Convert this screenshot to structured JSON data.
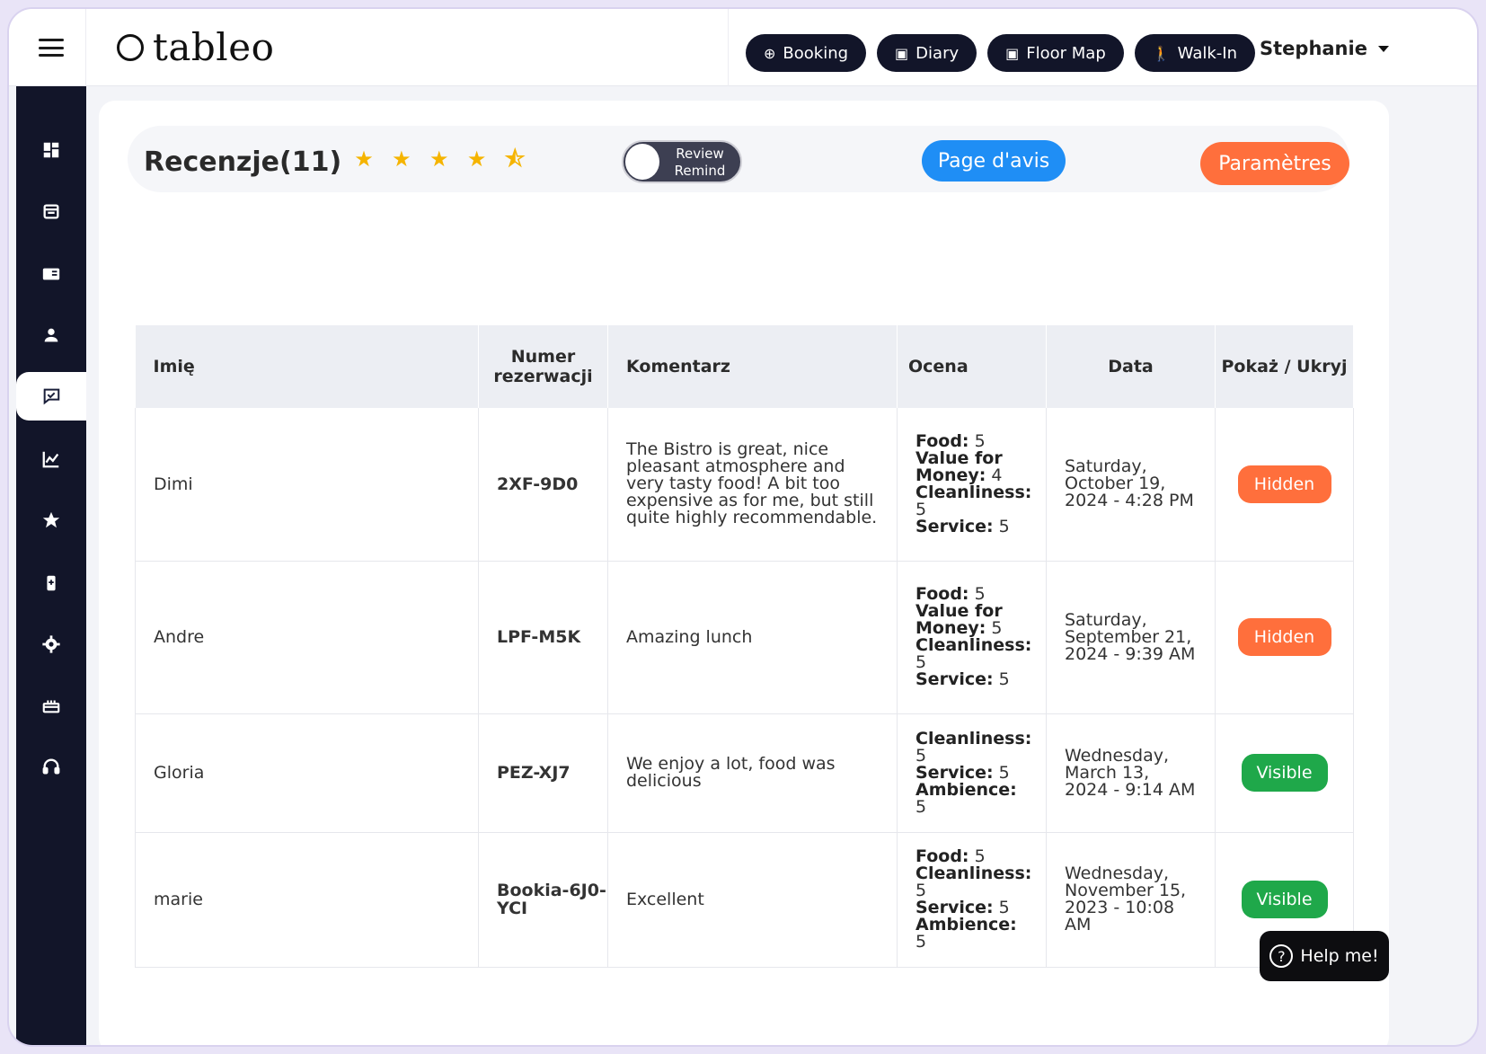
{
  "brand": {
    "logo_text": "tableo"
  },
  "topbar": {
    "actions": [
      {
        "label": "Booking",
        "icon": "plus-circle-icon"
      },
      {
        "label": "Diary",
        "icon": "calendar-icon"
      },
      {
        "label": "Floor Map",
        "icon": "map-icon"
      },
      {
        "label": "Walk-In",
        "icon": "walk-icon"
      }
    ],
    "user_name": "Stephanie"
  },
  "sidebar": {
    "items": [
      {
        "icon": "dashboard-icon"
      },
      {
        "icon": "calendar-icon"
      },
      {
        "icon": "book-icon"
      },
      {
        "icon": "user-icon"
      },
      {
        "icon": "review-icon",
        "active": true
      },
      {
        "icon": "chart-icon"
      },
      {
        "icon": "star-icon"
      },
      {
        "icon": "gift-card-icon"
      },
      {
        "icon": "gear-icon"
      },
      {
        "icon": "cake-icon"
      },
      {
        "icon": "headset-icon"
      }
    ]
  },
  "header": {
    "title": "Recenzje",
    "count": "(11)",
    "stars": "★ ★ ★ ★ ⯪",
    "toggle_label_line1": "Review",
    "toggle_label_line2": "Remind",
    "review_page_button": "Page d'avis",
    "settings_button": "Paramètres"
  },
  "table": {
    "headers": {
      "name": "Imię",
      "reservation": "Numer rezerwacji",
      "comment": "Komentarz",
      "rating": "Ocena",
      "date": "Data",
      "visibility": "Pokaż / Ukryj"
    },
    "rows": [
      {
        "name": "Dimi",
        "reservation": "2XF-9D0",
        "comment": "The Bistro is great, nice pleasant atmosphere and very tasty food! A bit too expensive as for me, but still quite highly recommendable.",
        "ratings": [
          {
            "label": "Food:",
            "value": "5"
          },
          {
            "label": "Value for Money:",
            "value": "4"
          },
          {
            "label": "Cleanliness:",
            "value": "5"
          },
          {
            "label": "Service:",
            "value": "5"
          }
        ],
        "date": "Saturday, October 19, 2024 - 4:28 PM",
        "status": "Hidden",
        "status_type": "hidden"
      },
      {
        "name": "Andre",
        "reservation": "LPF-M5K",
        "comment": "Amazing lunch",
        "ratings": [
          {
            "label": "Food:",
            "value": "5"
          },
          {
            "label": "Value for Money:",
            "value": "5"
          },
          {
            "label": "Cleanliness:",
            "value": "5"
          },
          {
            "label": "Service:",
            "value": "5"
          }
        ],
        "date": "Saturday, September 21, 2024 - 9:39 AM",
        "status": "Hidden",
        "status_type": "hidden"
      },
      {
        "name": "Gloria",
        "reservation": "PEZ-XJ7",
        "comment": "We enjoy a lot, food was delicious",
        "ratings": [
          {
            "label": "Cleanliness:",
            "value": "5"
          },
          {
            "label": "Service:",
            "value": "5"
          },
          {
            "label": "Ambience:",
            "value": "5"
          }
        ],
        "date": "Wednesday, March 13, 2024 - 9:14 AM",
        "status": "Visible",
        "status_type": "visible"
      },
      {
        "name": "marie",
        "reservation": "Bookia-6J0-YCI",
        "comment": "Excellent",
        "ratings": [
          {
            "label": "Food:",
            "value": "5"
          },
          {
            "label": "Cleanliness:",
            "value": "5"
          },
          {
            "label": "Service:",
            "value": "5"
          },
          {
            "label": "Ambience:",
            "value": "5"
          }
        ],
        "date": "Wednesday, November 15, 2023 - 10:08 AM",
        "status": "Visible",
        "status_type": "visible"
      }
    ]
  },
  "help": {
    "label": "Help me!"
  }
}
